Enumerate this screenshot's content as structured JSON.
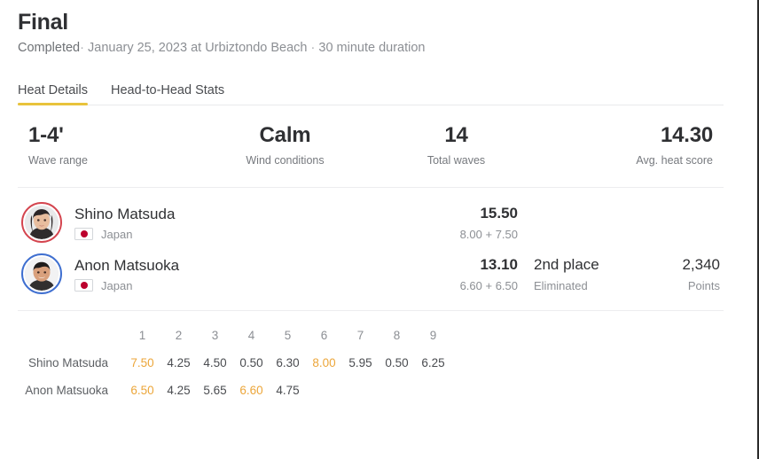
{
  "header": {
    "title": "Final",
    "status": "Completed",
    "separator": "·",
    "date": "January 25, 2023 at Urbiztondo Beach",
    "duration": "30 minute duration"
  },
  "tabs": [
    {
      "label": "Heat Details",
      "active": true
    },
    {
      "label": "Head-to-Head Stats",
      "active": false
    }
  ],
  "conditions": [
    {
      "value": "1-4'",
      "label": "Wave range"
    },
    {
      "value": "Calm",
      "label": "Wind conditions"
    },
    {
      "value": "14",
      "label": "Total waves"
    },
    {
      "value": "14.30",
      "label": "Avg. heat score"
    }
  ],
  "athletes": [
    {
      "name": "Shino Matsuda",
      "nation": "Japan",
      "jersey_color": "#d4454f",
      "total": "15.50",
      "total_breakdown": "8.00 + 7.50",
      "place": "",
      "place_status": "",
      "points": "",
      "points_label": ""
    },
    {
      "name": "Anon Matsuoka",
      "nation": "Japan",
      "jersey_color": "#3f6fd0",
      "total": "13.10",
      "total_breakdown": "6.60 + 6.50",
      "place": "2nd place",
      "place_status": "Eliminated",
      "points": "2,340",
      "points_label": "Points"
    }
  ],
  "wave_table": {
    "columns": [
      "1",
      "2",
      "3",
      "4",
      "5",
      "6",
      "7",
      "8",
      "9"
    ],
    "rows": [
      {
        "name": "Shino Matsuda",
        "scores": [
          "7.50",
          "4.25",
          "4.50",
          "0.50",
          "6.30",
          "8.00",
          "5.95",
          "0.50",
          "6.25"
        ],
        "counted": [
          true,
          false,
          false,
          false,
          false,
          true,
          false,
          false,
          false
        ]
      },
      {
        "name": "Anon Matsuoka",
        "scores": [
          "6.50",
          "4.25",
          "5.65",
          "6.60",
          "4.75"
        ],
        "counted": [
          true,
          false,
          false,
          true,
          false
        ]
      }
    ]
  },
  "colors": {
    "accent": "#e8c33c",
    "counted_score": "#eca63a",
    "flag_red": "#bc002d"
  }
}
